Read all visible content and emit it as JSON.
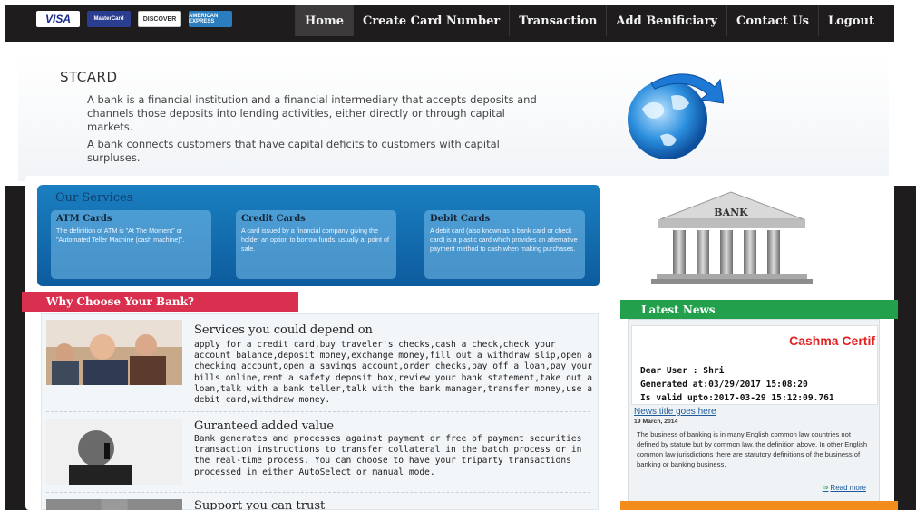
{
  "header": {
    "card_logos": [
      "VISA",
      "MasterCard",
      "DISCOVER",
      "AMERICAN EXPRESS"
    ],
    "nav": [
      {
        "label": "Home",
        "active": true
      },
      {
        "label": "Create Card Number"
      },
      {
        "label": "Transaction"
      },
      {
        "label": "Add Benificiary"
      },
      {
        "label": "Contact Us"
      },
      {
        "label": "Logout"
      }
    ]
  },
  "hero": {
    "brand": "STCARD",
    "p1": "A bank is a financial institution and a financial intermediary that accepts deposits and channels those deposits into lending activities, either directly or through capital markets.",
    "p2": "A bank connects customers that have capital deficits to customers with capital surpluses."
  },
  "services": {
    "title": "Our Services",
    "items": [
      {
        "title": "ATM Cards",
        "text": "The definition of ATM is \"At The Moment\" or \"Automated Teller Machine (cash machine)\"."
      },
      {
        "title": "Credit Cards",
        "text": "A card issued by a financial company giving the holder an option to borrow funds, usually at point of sale."
      },
      {
        "title": "Debit Cards",
        "text": "A debit card (also known as a bank card or check card) is a plastic card which provides an alternative payment method to cash when making purchases."
      }
    ]
  },
  "bank_image": {
    "label": "BANK"
  },
  "why": {
    "title": "Why Choose Your Bank?",
    "items": [
      {
        "title": "Services you could depend on",
        "text": "apply for a credit card,buy traveler's checks,cash a check,check your account balance,deposit money,exchange money,fill out a withdraw slip,open a checking account,open a savings account,order checks,pay off a loan,pay your bills online,rent a safety deposit box,review your bank statement,take out a loan,talk with a bank teller,talk with the bank manager,transfer money,use a debit card,withdraw money."
      },
      {
        "title": "Guranteed added value",
        "text": "Bank generates and processes against payment or free of payment securities transaction instructions to transfer collateral in the batch process or in the real-time process. You can choose to have your triparty transactions processed in either AutoSelect or manual mode."
      },
      {
        "title": "Support you can trust",
        "text": ""
      }
    ]
  },
  "news": {
    "title": "Latest News",
    "cert_title": "Cashma Certif",
    "dear": "Dear User : Shri",
    "generated": "Generated at:03/29/2017 15:08:20",
    "valid": "Is valid upto:2017-03-29 15:12:09.761",
    "link": "News title goes here",
    "date": "19 March, 2014",
    "text": "The business of banking is in many English common law countries not defined by statute but by common law, the definition above. In other English common law jurisdictions there are statutory definitions of the business of banking or banking business.",
    "read_more": "Read more"
  },
  "colors": {
    "why_header": "#d9304f",
    "news_header": "#22a04b",
    "services_bg": "#0d5c9e",
    "nav_bg": "#1f1c1d"
  }
}
